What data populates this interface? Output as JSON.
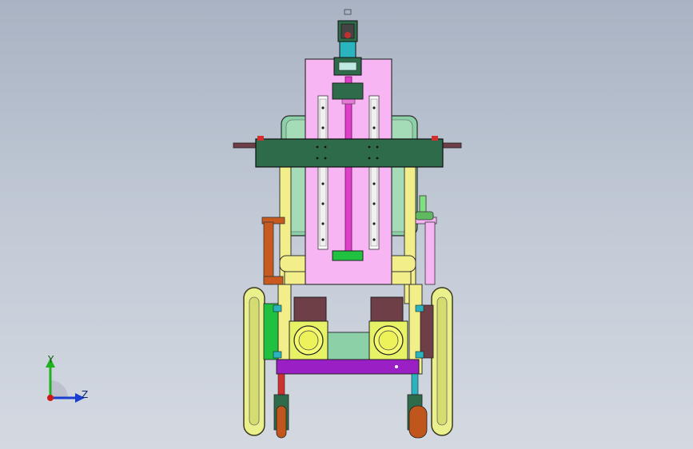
{
  "viewport": {
    "background_top": "#a9b3c3",
    "background_bottom": "#d4d9e1"
  },
  "model": {
    "part_colors": {
      "motor_mount": "#2e6b4a",
      "lift_plate": "#f7b6f3",
      "lead_screw": "#e040c8",
      "crossbar": "#2e6b4a",
      "battery_body": "#8cd0a8",
      "frame_yellow": "#f2ef8a",
      "base_plate": "#9a1fc4",
      "gearbox": "#e8f266",
      "gear_housing": "#6e3f46",
      "bracket": "#c85a20",
      "wheel": "#e9f08c",
      "caster_wheel": "#c0561c",
      "accent_cyan": "#2ab4c0",
      "accent_green": "#20c040"
    }
  },
  "triad": {
    "y_label": "Y",
    "z_label": "Z",
    "y_color": "#20b020",
    "z_color": "#1a3fd0",
    "x_color": "#d01818"
  }
}
